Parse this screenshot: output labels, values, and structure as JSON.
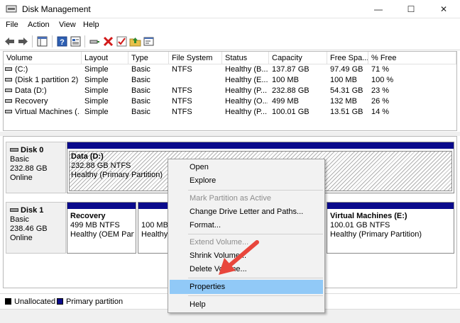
{
  "window": {
    "title": "Disk Management",
    "minimize": "—",
    "maximize": "☐",
    "close": "✕"
  },
  "menu": [
    "File",
    "Action",
    "View",
    "Help"
  ],
  "toolbar_icons": [
    "back-arrow-icon",
    "forward-arrow-icon",
    "console-tree-icon",
    "help-icon",
    "properties-icon",
    "connect-icon",
    "delete-icon",
    "check-icon",
    "folder-up-icon",
    "console-window-icon"
  ],
  "volume_list": {
    "headers": [
      "Volume",
      "Layout",
      "Type",
      "File System",
      "Status",
      "Capacity",
      "Free Spa...",
      "% Free"
    ],
    "rows": [
      [
        "(C:)",
        "Simple",
        "Basic",
        "NTFS",
        "Healthy (B...",
        "137.87 GB",
        "97.49 GB",
        "71 %"
      ],
      [
        "(Disk 1 partition 2)",
        "Simple",
        "Basic",
        "",
        "Healthy (E...",
        "100 MB",
        "100 MB",
        "100 %"
      ],
      [
        "Data (D:)",
        "Simple",
        "Basic",
        "NTFS",
        "Healthy (P...",
        "232.88 GB",
        "54.31 GB",
        "23 %"
      ],
      [
        "Recovery",
        "Simple",
        "Basic",
        "NTFS",
        "Healthy (O...",
        "499 MB",
        "132 MB",
        "26 %"
      ],
      [
        "Virtual Machines (...",
        "Simple",
        "Basic",
        "NTFS",
        "Healthy (P...",
        "100.01 GB",
        "13.51 GB",
        "14 %"
      ]
    ]
  },
  "disks": {
    "disk0": {
      "name": "Disk 0",
      "type": "Basic",
      "size": "232.88 GB",
      "state": "Online",
      "partition": {
        "name": "Data  (D:)",
        "size": "232.88 GB NTFS",
        "status": "Healthy (Primary Partition)"
      }
    },
    "disk1": {
      "name": "Disk 1",
      "type": "Basic",
      "size": "238.46 GB",
      "state": "Online",
      "partitions": [
        {
          "name": "Recovery",
          "size": "499 MB NTFS",
          "status": "Healthy (OEM Parti"
        },
        {
          "name": "",
          "size": "100 MB",
          "status": "Healthy"
        },
        {
          "name": "Virtual Machines  (E:)",
          "size": "100.01 GB NTFS",
          "status": "Healthy (Primary Partition)"
        }
      ]
    }
  },
  "legend": {
    "unallocated": "Unallocated",
    "primary": "Primary partition",
    "unallocated_color": "#000000",
    "primary_color": "#0a0a8c"
  },
  "context_menu": {
    "items": [
      {
        "label": "Open",
        "enabled": true
      },
      {
        "label": "Explore",
        "enabled": true
      },
      {
        "label": "Mark Partition as Active",
        "enabled": false
      },
      {
        "label": "Change Drive Letter and Paths...",
        "enabled": true
      },
      {
        "label": "Format...",
        "enabled": true
      },
      {
        "label": "Extend Volume...",
        "enabled": false
      },
      {
        "label": "Shrink Volume...",
        "enabled": true
      },
      {
        "label": "Delete Volume...",
        "enabled": true
      },
      {
        "label": "Properties",
        "enabled": true,
        "highlighted": true
      },
      {
        "label": "Help",
        "enabled": true
      }
    ]
  },
  "accent_colors": {
    "highlight": "#91c9f7",
    "arrow": "#e8463c",
    "partition_bar": "#0a0a8c"
  }
}
